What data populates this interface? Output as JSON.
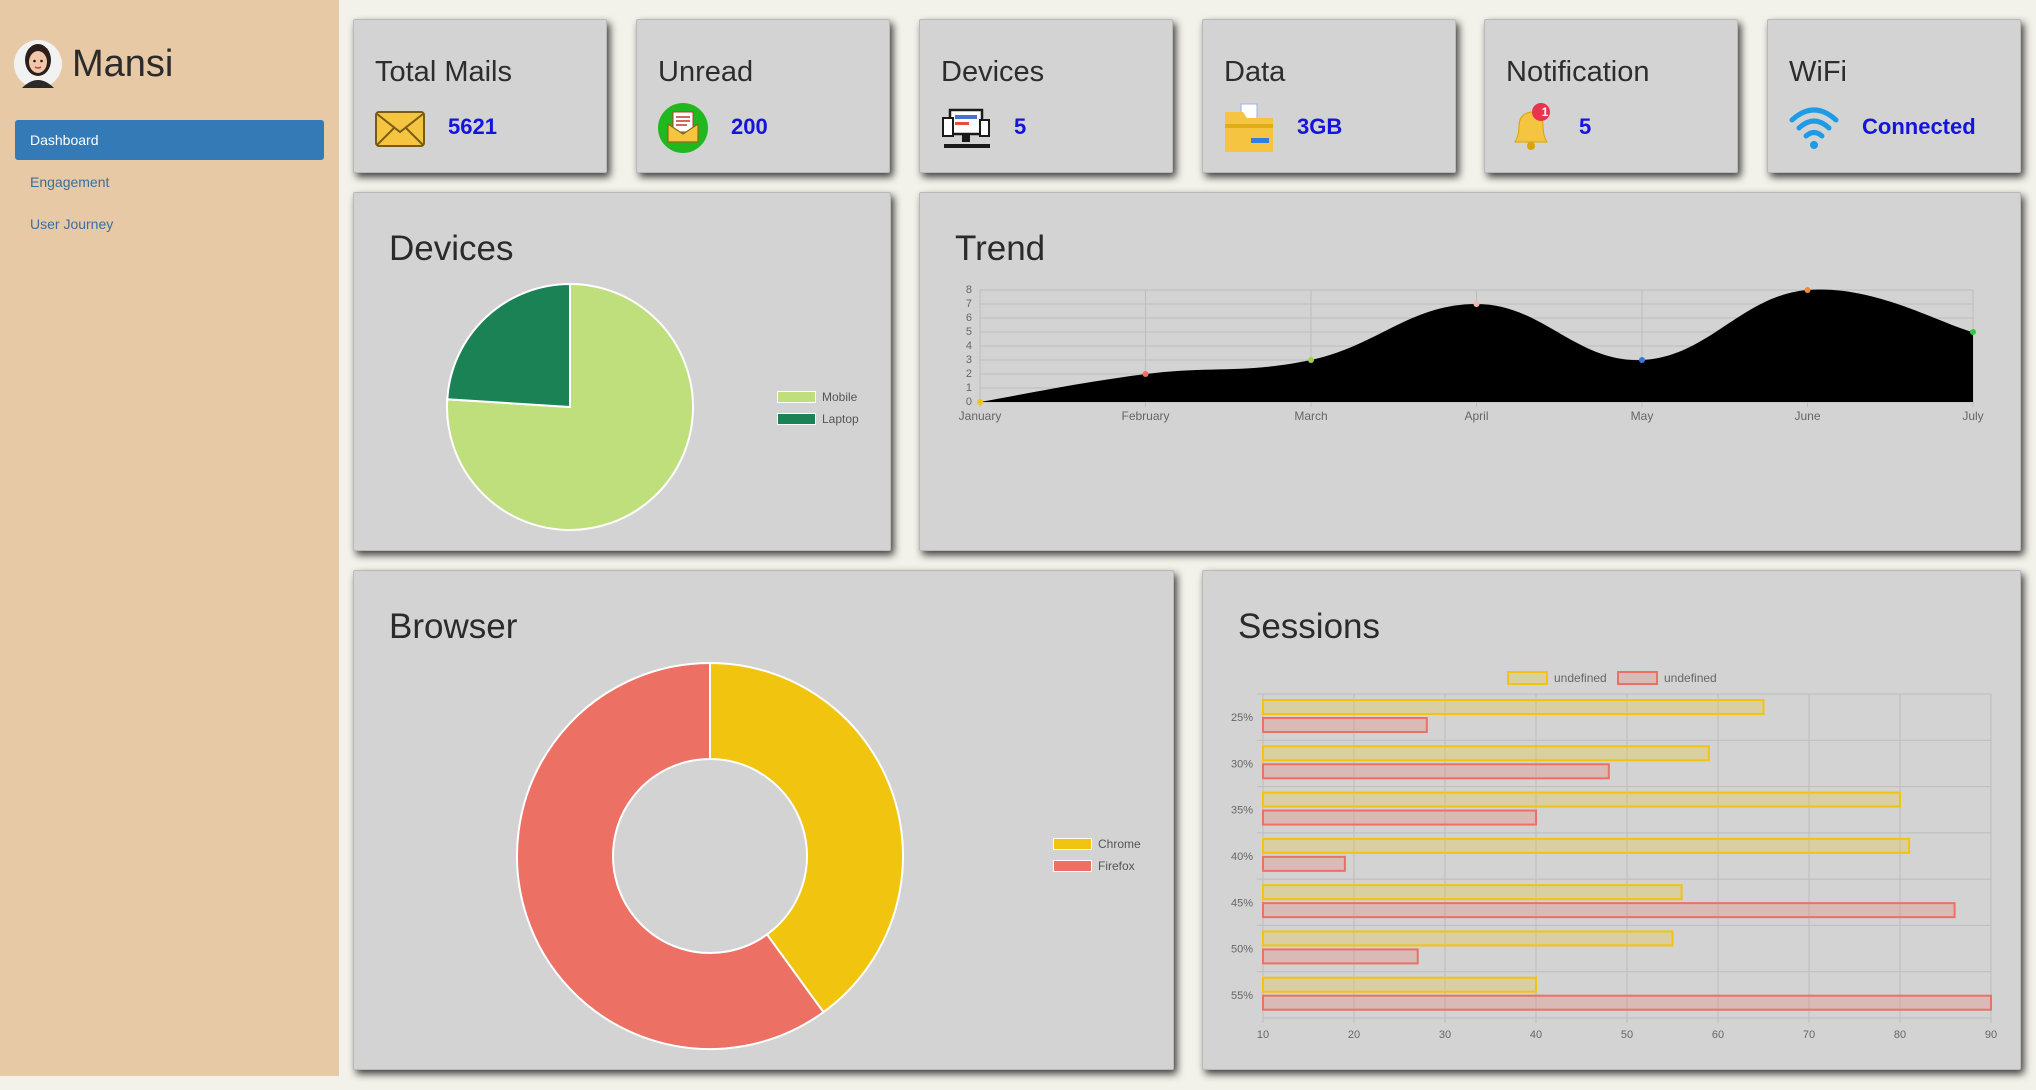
{
  "sidebar": {
    "user_name": "Mansi",
    "nav": [
      {
        "label": "Dashboard",
        "active": true
      },
      {
        "label": "Engagement",
        "active": false
      },
      {
        "label": "User Journey",
        "active": false
      }
    ]
  },
  "stats": [
    {
      "title": "Total Mails",
      "value": "5621",
      "icon": "envelope-icon"
    },
    {
      "title": "Unread",
      "value": "200",
      "icon": "open-mail-icon"
    },
    {
      "title": "Devices",
      "value": "5",
      "icon": "computer-devices-icon"
    },
    {
      "title": "Data",
      "value": "3GB",
      "icon": "folder-icon"
    },
    {
      "title": "Notification",
      "value": "5",
      "icon": "bell-icon",
      "badge": "1"
    },
    {
      "title": "WiFi",
      "value": "Connected",
      "icon": "wifi-icon"
    }
  ],
  "panels": {
    "devices_title": "Devices",
    "trend_title": "Trend",
    "browser_title": "Browser",
    "sessions_title": "Sessions"
  },
  "colors": {
    "accent": "#337ab7",
    "value_text": "#1414dd",
    "mobile": "#bedf7c",
    "laptop": "#1b8255",
    "chrome": "#f1c40f",
    "firefox": "#ec7063"
  },
  "chart_data": [
    {
      "id": "devices",
      "type": "pie",
      "labels": [
        "Mobile",
        "Laptop"
      ],
      "values": [
        76,
        24
      ],
      "colors": [
        "#bedf7c",
        "#1b8255"
      ],
      "legend": "right"
    },
    {
      "id": "trend",
      "type": "area",
      "categories": [
        "January",
        "February",
        "March",
        "April",
        "May",
        "June",
        "July"
      ],
      "values": [
        0,
        2,
        3,
        7,
        3,
        8,
        5
      ],
      "ylim": [
        0,
        8
      ],
      "yticks": [
        0,
        1,
        2,
        3,
        4,
        5,
        6,
        7,
        8
      ],
      "fill": "#000000",
      "point_colors": [
        "#f1c40f",
        "#ec7063",
        "#9bd34a",
        "#f5b7b1",
        "#3a78d6",
        "#f08a3e",
        "#2ecc40"
      ],
      "grid": true
    },
    {
      "id": "browser",
      "type": "pie",
      "style": "doughnut",
      "labels": [
        "Chrome",
        "Firefox"
      ],
      "values": [
        40,
        60
      ],
      "colors": [
        "#f1c40f",
        "#ec7063"
      ],
      "legend": "right"
    },
    {
      "id": "sessions",
      "type": "bar",
      "orientation": "horizontal",
      "categories": [
        "25%",
        "30%",
        "35%",
        "40%",
        "45%",
        "50%",
        "55%"
      ],
      "series": [
        {
          "name": "undefined",
          "values": [
            65,
            59,
            80,
            81,
            56,
            55,
            40
          ],
          "color": "#f1c40f"
        },
        {
          "name": "undefined",
          "values": [
            28,
            48,
            40,
            19,
            86,
            27,
            90
          ],
          "color": "#ec7063"
        }
      ],
      "xlim": [
        10,
        90
      ],
      "xticks": [
        10,
        20,
        30,
        40,
        50,
        60,
        70,
        80,
        90
      ],
      "legend": "top",
      "grid": true
    }
  ]
}
